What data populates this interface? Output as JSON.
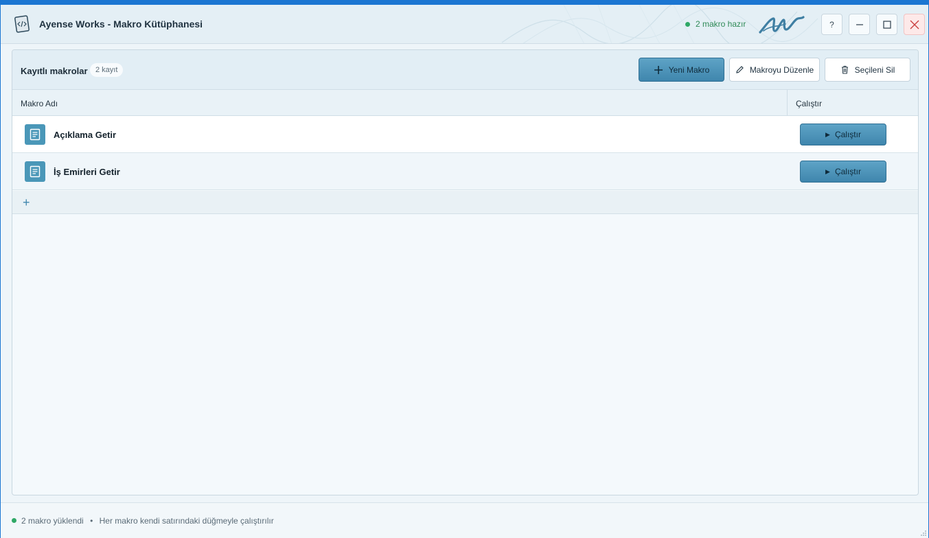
{
  "window": {
    "title": "Ayense Works - Makro Kütüphanesi",
    "status": "2 makro hazır",
    "help_label": "?"
  },
  "toolbar": {
    "heading": "Kayıtlı makrolar",
    "count_badge": "2 kayıt",
    "new_label": "Yeni Makro",
    "edit_label": "Makroyu Düzenle",
    "delete_label": "Seçileni Sil"
  },
  "table": {
    "columns": [
      "Makro Adı",
      "Çalıştır"
    ],
    "rows": [
      {
        "name": "Açıklama Getir",
        "action": "Çalıştır"
      },
      {
        "name": "İş Emirleri Getir",
        "action": "Çalıştır"
      }
    ],
    "add_symbol": "+"
  },
  "footer": {
    "loaded": "2 makro yüklendi",
    "separator": "•",
    "hint": "Her makro kendi satırındaki düğmeyle çalıştırılır"
  },
  "colors": {
    "accent": "#3f86ad",
    "status_green": "#2fa866",
    "frame_blue": "#1b76d2"
  }
}
